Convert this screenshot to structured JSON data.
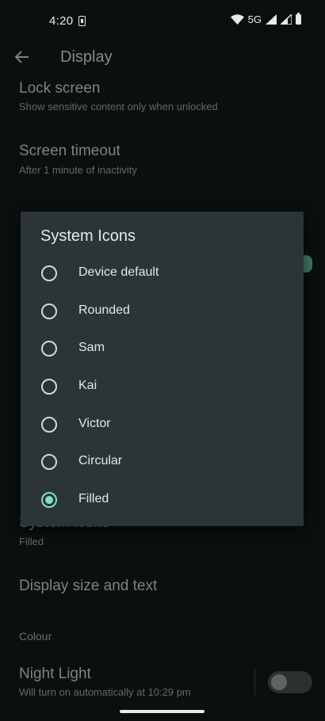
{
  "status_bar": {
    "time": "4:20",
    "network": "5G"
  },
  "header": {
    "title": "Display"
  },
  "background_list": {
    "lock_screen": {
      "title": "Lock screen",
      "subtitle": "Show sensitive content only when unlocked"
    },
    "screen_timeout": {
      "title": "Screen timeout",
      "subtitle": "After 1 minute of inactivity"
    },
    "system_icons": {
      "title": "System Icons",
      "subtitle": "Filled"
    },
    "display_size": {
      "title": "Display size and text"
    },
    "colour_section": "Colour",
    "night_light": {
      "title": "Night Light",
      "subtitle": "Will turn on automatically at 10:29 pm",
      "enabled": false
    }
  },
  "dialog": {
    "title": "System Icons",
    "options": [
      {
        "label": "Device default",
        "selected": false
      },
      {
        "label": "Rounded",
        "selected": false
      },
      {
        "label": "Sam",
        "selected": false
      },
      {
        "label": "Kai",
        "selected": false
      },
      {
        "label": "Victor",
        "selected": false
      },
      {
        "label": "Circular",
        "selected": false
      },
      {
        "label": "Filled",
        "selected": true
      }
    ]
  },
  "colors": {
    "accent": "#7fe0c4",
    "dialog_bg": "#2c3535",
    "page_bg": "#0b0f0f"
  }
}
